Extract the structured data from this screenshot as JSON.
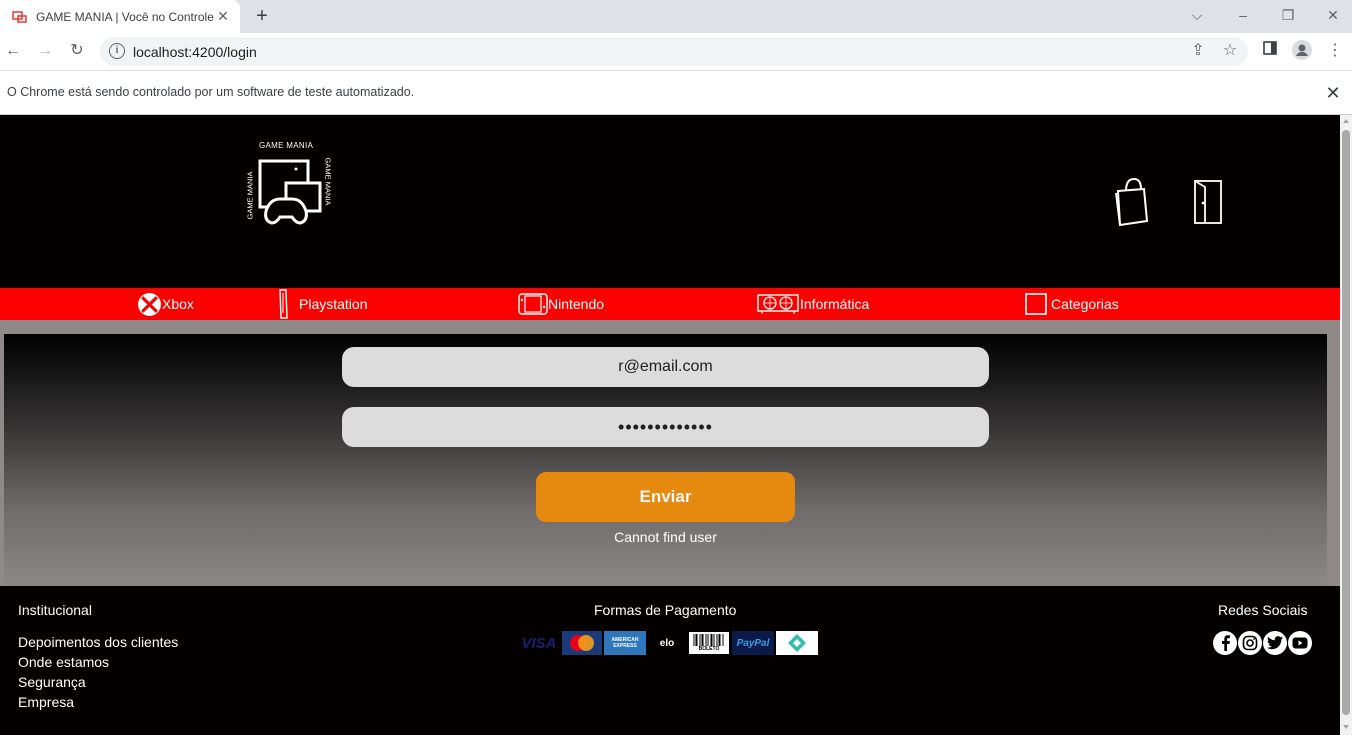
{
  "browser": {
    "tab_title": "GAME MANIA | Você no Controle",
    "url": "localhost:4200/login",
    "infobar_text": "O Chrome está sendo controlado por um software de teste automatizado."
  },
  "logo": {
    "top_text": "GAME MANIA",
    "side_left_text": "GAME MANIA",
    "side_right_text": "GAME MANIA"
  },
  "nav": {
    "items": [
      {
        "label": "Xbox",
        "icon": "xbox-icon"
      },
      {
        "label": "Playstation",
        "icon": "playstation-icon"
      },
      {
        "label": "Nintendo",
        "icon": "nintendo-switch-icon"
      },
      {
        "label": "Informática",
        "icon": "graphics-card-icon"
      },
      {
        "label": "Categorias",
        "icon": "square-icon"
      }
    ]
  },
  "login": {
    "email_value": "r@email.com",
    "password_value": "•••••••••••••",
    "submit_label": "Enviar",
    "error_message": "Cannot find user"
  },
  "footer": {
    "institutional_heading": "Institucional",
    "institutional_links": [
      "Depoimentos dos clientes",
      "Onde estamos",
      "Segurança",
      "Empresa"
    ],
    "payment_heading": "Formas de Pagamento",
    "payment_methods": [
      "VISA",
      "MasterCard",
      "AMERICAN EXPRESS",
      "elo",
      "BOLETO",
      "PayPal",
      "Pix"
    ],
    "social_heading": "Redes Sociais",
    "social_icons": [
      "facebook-icon",
      "instagram-icon",
      "twitter-icon",
      "youtube-icon"
    ]
  },
  "colors": {
    "nav_red": "#fb0000",
    "button_orange": "#e5890f",
    "page_black": "#050000",
    "input_grey": "#dcdcdc"
  }
}
